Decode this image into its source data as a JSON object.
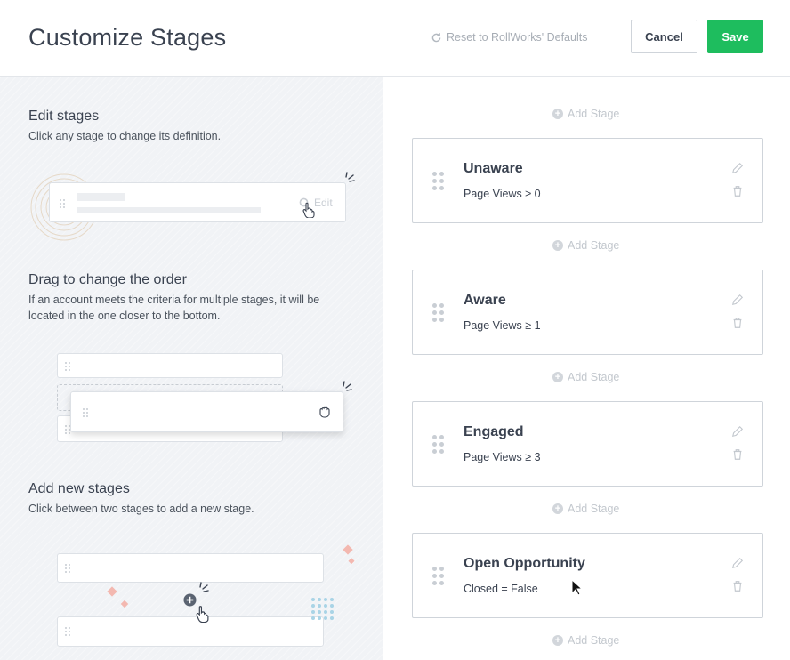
{
  "header": {
    "title": "Customize Stages",
    "reset_label": "Reset to RollWorks' Defaults",
    "cancel_label": "Cancel",
    "save_label": "Save"
  },
  "help": {
    "edit": {
      "title": "Edit stages",
      "desc": "Click any stage to change its definition.",
      "illus_edit_label": "Edit"
    },
    "drag": {
      "title": "Drag to change the order",
      "desc": "If an account meets the criteria for multiple stages, it will be located in the one closer to the bottom."
    },
    "add": {
      "title": "Add new stages",
      "desc": "Click between two stages to add a new stage."
    }
  },
  "add_stage_label": "Add Stage",
  "stages": [
    {
      "name": "Unaware",
      "rule": "Page Views ≥ 0"
    },
    {
      "name": "Aware",
      "rule": "Page Views ≥ 1"
    },
    {
      "name": "Engaged",
      "rule": "Page Views ≥ 3"
    },
    {
      "name": "Open Opportunity",
      "rule": "Closed = False"
    }
  ],
  "colors": {
    "save": "#1ebd5e",
    "accent_pink": "#f3b8b0",
    "accent_blue": "#a9d4e6"
  },
  "icons": [
    "reset-icon",
    "plus-circle-icon",
    "drag-handle-icon",
    "pencil-icon",
    "trash-icon",
    "hand-pointer-icon",
    "grab-hand-icon"
  ]
}
